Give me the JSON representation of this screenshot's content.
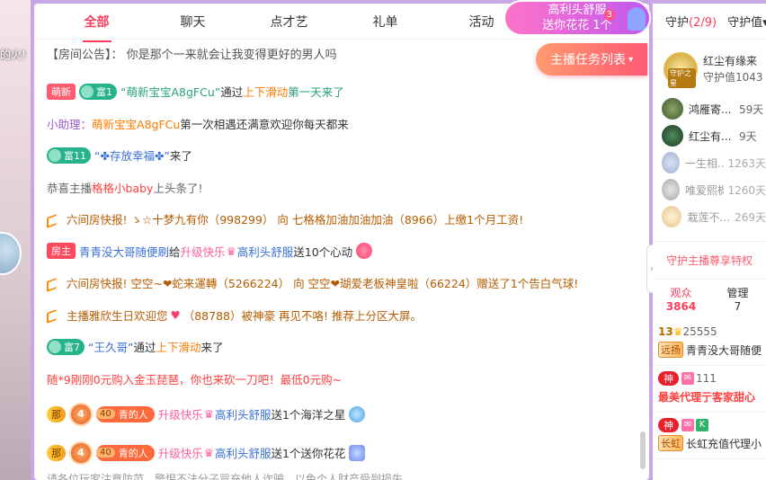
{
  "left_strip": {
    "flame_text": "的火!"
  },
  "tabs": [
    {
      "label": "全部",
      "active": true
    },
    {
      "label": "聊天",
      "active": false
    },
    {
      "label": "点才艺",
      "active": false
    },
    {
      "label": "礼单",
      "active": false
    },
    {
      "label": "活动",
      "active": false
    }
  ],
  "promo": {
    "line1": "高利头舒服",
    "line2": "送你花花 1个",
    "count": "3"
  },
  "announcement": "【房间公告】： 你是那个一来就会让我变得更好的男人吗",
  "task_button": "主播任务列表",
  "messages": {
    "m1": {
      "badge1": "萌新",
      "badge2": "富1",
      "name": "“萌新宝宝A8gFCu”",
      "via": "通过",
      "method": "上下滑动",
      "rest": "第一天来了"
    },
    "m2": {
      "prefix": "小助理：",
      "name": "萌新宝宝A8gFCu",
      "text": " 第一次相遇还满意欢迎你每天都来"
    },
    "m3": {
      "badge": "富11",
      "name": "“✤存放幸福✤”",
      "rest": "来了"
    },
    "m4": {
      "prefix": "恭喜主播 ",
      "name": "格格小baby",
      "rest": " 上头条了!"
    },
    "m5": {
      "text": "六间房快报! ゝ☆十梦九有你（998299） 向 七格格加油加油加油（8966）上缴1个月工资!"
    },
    "m6": {
      "badge": "房主",
      "name": "青青没大哥随便刷",
      "gave": " 给 ",
      "upgrade": "升级快乐",
      "target": "高利头舒服",
      "gift": " 送10个心动"
    },
    "m7": {
      "text": "六间房快报! 空空~❤蛇来運轉（5266224） 向 空空❤瑚爱老板神皇啦（66224）赠送了1个告白气球!"
    },
    "m8": {
      "text": "主播雅欣生日欢迎您",
      "id": "（88788）",
      "rest": " 被神豪 再见不咯!  推荐上分区大屏。"
    },
    "m9": {
      "badge": "富7",
      "name": "“王久哥”",
      "via": "通过",
      "method": "上下滑动",
      "rest": "来了"
    },
    "m10": {
      "text": "随*9刚刚0元购入金玉琵琶，你也来砍一刀吧！最低0元购~"
    },
    "m11": {
      "badge_gold": "那",
      "lv": "4",
      "level_num": "40",
      "level_name": "青的人",
      "upgrade": "升级快乐",
      "target": "高利头舒服",
      "gift": " 送1个海洋之星"
    },
    "m12": {
      "badge_gold": "那",
      "lv": "4",
      "level_num": "40",
      "level_name": "青的人",
      "upgrade": "升级快乐",
      "target": "高利头舒服",
      "gift": " 送1个送你花花"
    }
  },
  "bottom_text": "请各位玩家注意防范，警惕不法分子冒充他人诈骗，以免个人财产受到损失",
  "right": {
    "tab_guard": "守护",
    "guard_count": "(2/9)",
    "tab_guard_value": "守护值",
    "top_guard": {
      "name": "红尘有缘来",
      "label": "守护值1043",
      "tag": "守护之星"
    },
    "guards": [
      {
        "name": "鸿雁寄...",
        "days": "59天",
        "faded": false
      },
      {
        "name": "红尘有...",
        "days": "9天",
        "faded": false
      },
      {
        "name": "一生相...",
        "days": "1263天",
        "faded": true
      },
      {
        "name": "唯爱熙枫",
        "days": "1260天",
        "faded": true
      },
      {
        "name": "栽莲不...",
        "days": "269天",
        "faded": true
      }
    ],
    "privilege": "守护主播尊享特权",
    "viewer_tab": {
      "label": "观众",
      "count": "3864"
    },
    "manager_tab": {
      "label": "管理",
      "count": "7"
    },
    "viewers": [
      {
        "top_text": "13",
        "top_id": "25555",
        "tag": "远扬",
        "name": "青青没大哥随便"
      },
      {
        "top_text": "神",
        "top_extra": "111",
        "tag": "最美代理",
        "name": "亍客家甜心"
      },
      {
        "top_text": "神",
        "top_extra": "",
        "tag": "长虹",
        "name": "长虹充值代理小"
      }
    ]
  },
  "colors": {
    "accent": "#ff3d5a",
    "orange": "#ff7b00",
    "blue": "#3a6fd8"
  }
}
